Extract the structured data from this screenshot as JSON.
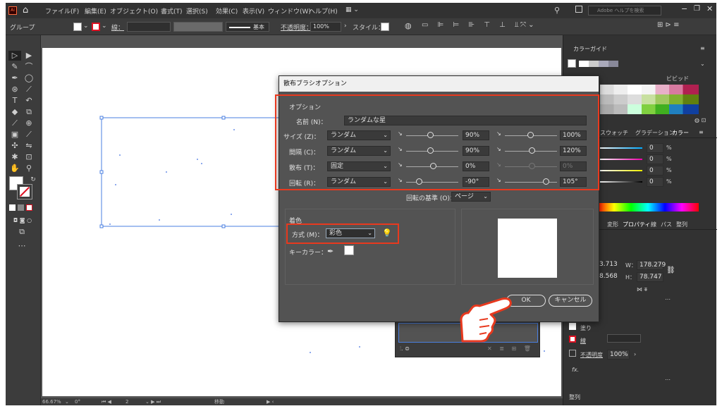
{
  "menubar": {
    "items": [
      "ファイル(F)",
      "編集(E)",
      "オブジェクト(O)",
      "書式(T)",
      "選択(S)",
      "効果(C)",
      "表示(V)",
      "ウィンドウ(W)",
      "ヘルプ(H)"
    ],
    "search_placeholder": "Adobe ヘルプを検索"
  },
  "controlbar": {
    "selection_label": "グループ",
    "stroke_label": "線：",
    "brush_label": "基本",
    "opacity_label": "不透明度：",
    "opacity_value": "100%",
    "style_label": "スタイル："
  },
  "dialog": {
    "title": "散布ブラシオプション",
    "options_section": "オプション",
    "name_label": "名前 (N)：",
    "name_value": "ランダムな星",
    "rows": [
      {
        "label": "サイズ (Z)：",
        "mode": "ランダム",
        "min": "90%",
        "max": "100%"
      },
      {
        "label": "間隔 (C)：",
        "mode": "ランダム",
        "min": "90%",
        "max": "120%"
      },
      {
        "label": "散布 (T)：",
        "mode": "固定",
        "min": "0%",
        "max": "0%"
      },
      {
        "label": "回転 (R)：",
        "mode": "ランダム",
        "min": "-90°",
        "max": "105°"
      }
    ],
    "rotation_basis_label": "回転の基準 (O)：",
    "rotation_basis_value": "ページ",
    "colorize_section": "着色",
    "method_label": "方式 (M)：",
    "method_value": "彩色",
    "key_color_label": "キーカラー：",
    "ok_label": "OK",
    "cancel_label": "キャンセル"
  },
  "right_panel": {
    "swatch_panel_tab": "カラーガイド",
    "vivid_label": "ビビッド",
    "color_tabs": [
      "スウォッチ",
      "グラデーション",
      "カラー"
    ],
    "color_values": [
      "0",
      "0",
      "0",
      "0"
    ],
    "color_unit": "%",
    "properties_tabs": [
      "変形",
      "プロパティ",
      "線",
      "パス",
      "整列"
    ],
    "x_value": "3.713",
    "w_label": "W：",
    "w_value": "178.279",
    "y_value": "8.568",
    "h_label": "H：",
    "h_value": "78.747",
    "fill_label": "塗り",
    "stroke_label": "線",
    "opacity_label": "不透明度",
    "opacity_value": "100%",
    "fx_label": "fx.",
    "align_label": "整列"
  },
  "statusbar": {
    "zoom": "66.67%",
    "rotation": "0°",
    "artboard_number": "2",
    "tool_name": "移動"
  },
  "colors": {
    "accent_red": "#e8391e",
    "dialog_bg": "#535353",
    "selection_blue": "#4a7fe0"
  }
}
